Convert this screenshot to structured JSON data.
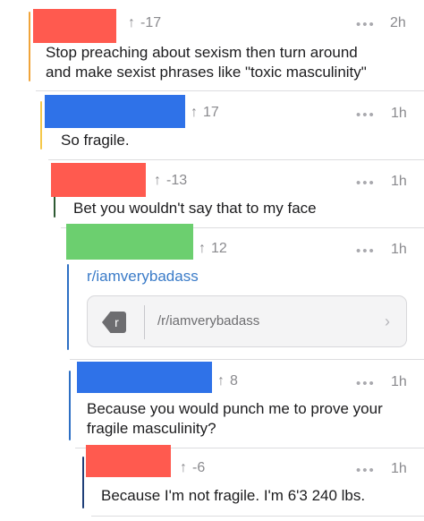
{
  "colors": {
    "red": "#ff5a4f",
    "blue": "#2f72e8",
    "green": "#6ccf6f",
    "bar_orange": "#f0a43a",
    "bar_yellow": "#f5c84a",
    "bar_darkgreen": "#2e5a33",
    "bar_blue": "#2d6fc4",
    "bar_navy": "#1f3f78",
    "link": "#3a7bc8"
  },
  "icons": {
    "upvote": "upvote-arrow-icon",
    "more": "more-dots-icon",
    "subreddit": "subreddit-r-icon",
    "chevron": "chevron-right-icon"
  },
  "comments": [
    {
      "score": "-17",
      "age": "2h",
      "username_color": "red",
      "text_lines": [
        "Stop preaching about sexism then turn around",
        "and make sexist phrases like \"toxic masculinity\""
      ]
    },
    {
      "score": "17",
      "age": "1h",
      "username_color": "blue",
      "text_lines": [
        "So fragile."
      ]
    },
    {
      "score": "-13",
      "age": "1h",
      "username_color": "red",
      "text_lines": [
        "Bet you wouldn't say that to my face"
      ]
    },
    {
      "score": "12",
      "age": "1h",
      "username_color": "green",
      "link_text": "r/iamverybadass",
      "card": {
        "icon_letter": "r",
        "url": "/r/iamverybadass"
      }
    },
    {
      "score": "8",
      "age": "1h",
      "username_color": "blue",
      "text_lines": [
        "Because you would punch me to prove your",
        "fragile masculinity?"
      ]
    },
    {
      "score": "-6",
      "age": "1h",
      "username_color": "red",
      "text_lines": [
        "Because I'm not fragile. I'm 6'3 240 lbs."
      ]
    }
  ],
  "ui": {
    "upvote_glyph": "↑",
    "more_glyph": "•••",
    "chevron_glyph": "›"
  }
}
